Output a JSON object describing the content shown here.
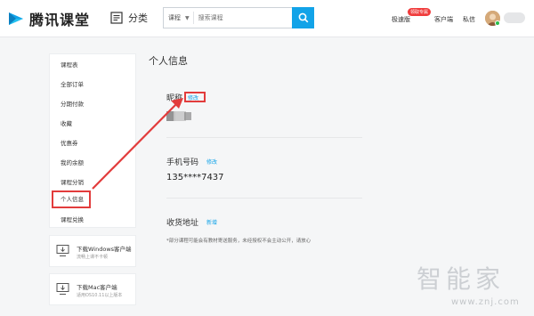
{
  "header": {
    "logo_text": "腾讯课堂",
    "category_label": "分类",
    "search_scope": "课程",
    "search_placeholder": "搜索课程",
    "nav": {
      "speed": "极速版",
      "speed_badge": "领取专属",
      "client": "客户端",
      "messages": "私信"
    }
  },
  "sidebar": {
    "items": [
      {
        "label": "课程表"
      },
      {
        "label": "全部订单"
      },
      {
        "label": "分期付款"
      },
      {
        "label": "收藏"
      },
      {
        "label": "优惠券"
      },
      {
        "label": "我的余额"
      },
      {
        "label": "课程分销"
      },
      {
        "label": "个人信息",
        "active": true
      },
      {
        "label": "课程兑换"
      }
    ],
    "downloads": [
      {
        "title": "下载Windows客户端",
        "subtitle": "流畅上课不卡顿"
      },
      {
        "title": "下载Mac客户端",
        "subtitle": "适用OS10.11以上版本"
      }
    ]
  },
  "main": {
    "page_title": "个人信息",
    "nickname_label": "昵称",
    "nickname_edit": "修改",
    "phone_label": "手机号码",
    "phone_edit": "修改",
    "phone_value": "135****7437",
    "address_label": "收货地址",
    "address_add": "新增",
    "note": "*部分课程可能会有教材寄送服务，未经授权不会主动公开，请放心"
  },
  "watermark": {
    "text": "智能家",
    "url": "www.znj.com"
  },
  "colors": {
    "accent": "#12a3e8",
    "highlight": "#e23c3c"
  }
}
